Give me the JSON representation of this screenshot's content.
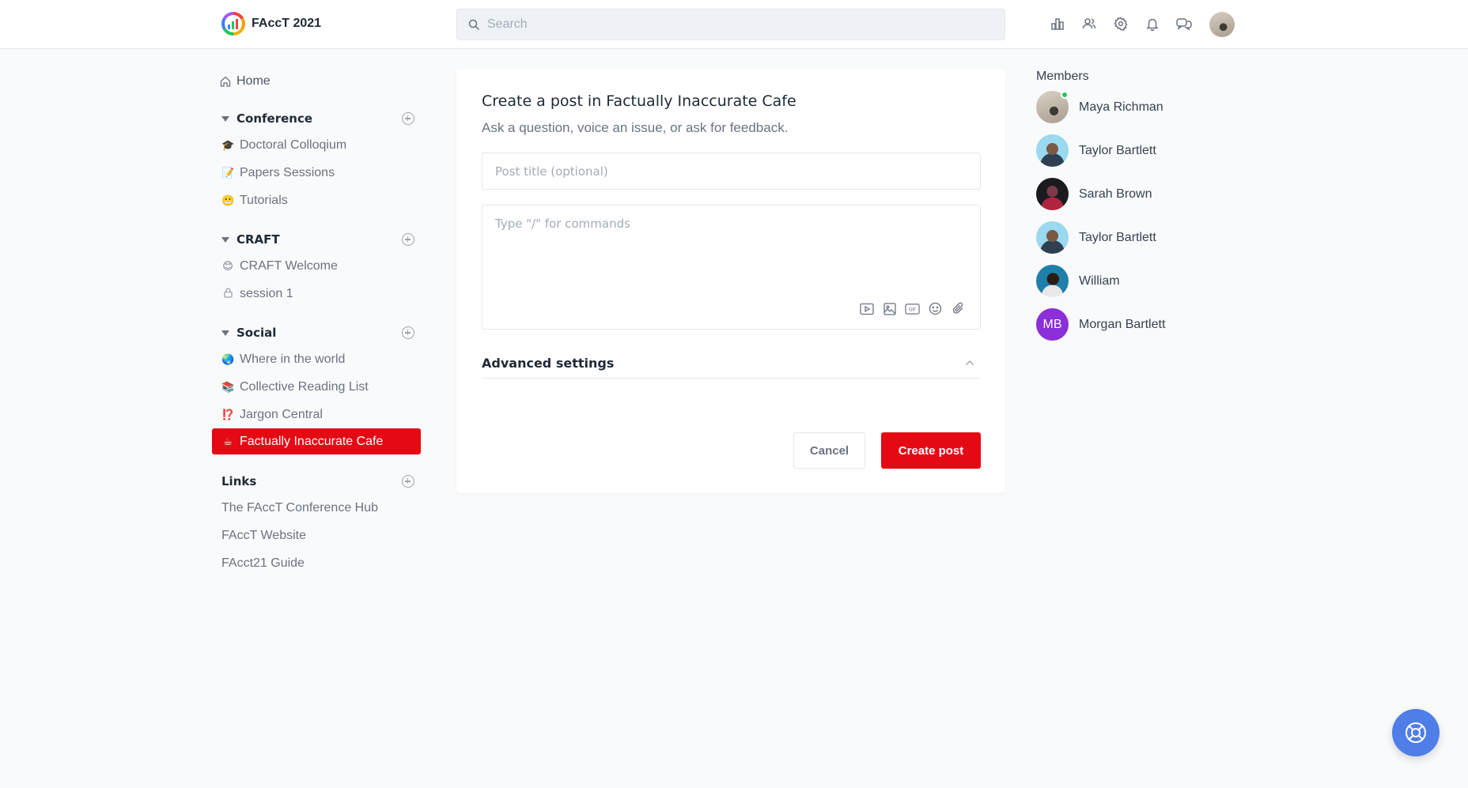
{
  "app": {
    "name": "FAccT 2021"
  },
  "search": {
    "placeholder": "Search"
  },
  "header_icons": [
    "bar-chart-icon",
    "users-icon",
    "gear-icon",
    "bell-icon",
    "chat-icon"
  ],
  "sidebar": {
    "home": "Home",
    "sections": [
      {
        "title": "Conference",
        "items": [
          {
            "emoji": "🎓",
            "label": "Doctoral Colloqium"
          },
          {
            "emoji": "📝",
            "label": "Papers Sessions"
          },
          {
            "emoji": "😬",
            "label": "Tutorials"
          }
        ]
      },
      {
        "title": "CRAFT",
        "items": [
          {
            "emoji": "😊",
            "label": "CRAFT Welcome"
          },
          {
            "emoji": "🔒",
            "label": "session 1"
          }
        ]
      },
      {
        "title": "Social",
        "items": [
          {
            "emoji": "🌏",
            "label": "Where in the world"
          },
          {
            "emoji": "📚",
            "label": "Collective Reading List"
          },
          {
            "emoji": "⁉️",
            "label": "Jargon Central"
          },
          {
            "emoji": "☕",
            "label": "Factually Inaccurate Cafe",
            "active": true
          }
        ]
      }
    ],
    "links": {
      "title": "Links",
      "items": [
        "The FAccT Conference Hub",
        "FAccT Website",
        "FAcct21 Guide"
      ]
    }
  },
  "post_form": {
    "title": "Create a post in Factually Inaccurate Cafe",
    "subtitle": "Ask a question, voice an issue, or ask for feedback.",
    "title_placeholder": "Post title (optional)",
    "body_placeholder": "Type \"/\" for commands",
    "tools": [
      "video-icon",
      "image-icon",
      "gif-icon",
      "emoji-icon",
      "attachment-icon"
    ],
    "advanced_settings": "Advanced settings",
    "cancel": "Cancel",
    "create": "Create post"
  },
  "members": {
    "title": "Members",
    "list": [
      {
        "name": "Maya Richman",
        "online": true
      },
      {
        "name": "Taylor Bartlett"
      },
      {
        "name": "Sarah Brown"
      },
      {
        "name": "Taylor Bartlett"
      },
      {
        "name": "William"
      },
      {
        "name": "Morgan Bartlett",
        "initials": "MB"
      }
    ]
  },
  "colors": {
    "accent": "#e50914",
    "help_button": "#4f7ee8",
    "online": "#22c55e"
  }
}
